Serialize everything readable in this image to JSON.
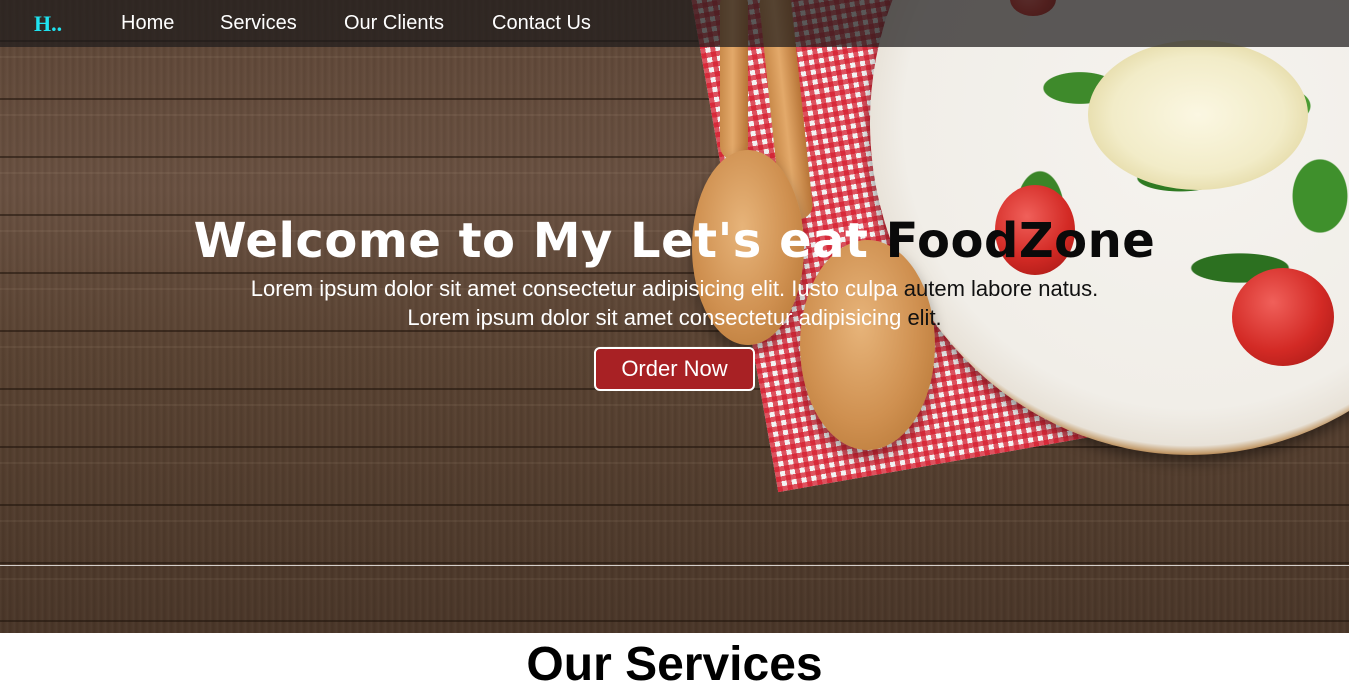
{
  "navbar": {
    "logo": "H..",
    "links": [
      {
        "label": "Home"
      },
      {
        "label": "Services"
      },
      {
        "label": "Our Clients"
      },
      {
        "label": "Contact Us"
      }
    ]
  },
  "hero": {
    "title_main": "Welcome to My Let's eat ",
    "title_accent": "FoodZone",
    "text_line1_a": "Lorem ipsum dolor sit amet consectetur adipisicing elit. Iusto culpa ",
    "text_line1_b": "autem labore natus.",
    "text_line2_a": "Lorem ipsum dolor sit amet consectetur adipisicing ",
    "text_line2_b": "elit.",
    "button_label": "Order Now"
  },
  "services_section": {
    "heading": "Our Services"
  },
  "colors": {
    "logo": "#1fe3f0",
    "button_bg": "#a82124",
    "navbar_bg": "rgba(30,28,28,0.72)"
  }
}
